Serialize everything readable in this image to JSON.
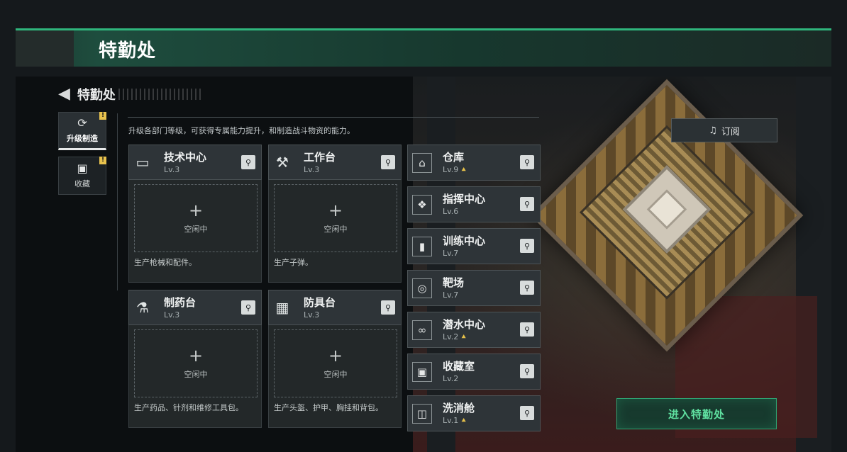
{
  "header": {
    "title": "特勤处"
  },
  "page": {
    "back_title": "特勤处",
    "description": "升级各部门等级，可获得专属能力提升，和制造战斗物资的能力。"
  },
  "sidebar": {
    "tabs": [
      {
        "label": "升级制造",
        "icon": "upgrade-icon",
        "badge": "!"
      },
      {
        "label": "收藏",
        "icon": "collection-icon",
        "badge": "!"
      }
    ]
  },
  "stations": [
    {
      "name": "技术中心",
      "level": "Lv.3",
      "icon": "tech-center-icon",
      "slot_plus": "+",
      "slot_status": "空闲中",
      "desc": "生产枪械和配件。"
    },
    {
      "name": "工作台",
      "level": "Lv.3",
      "icon": "workbench-icon",
      "slot_plus": "+",
      "slot_status": "空闲中",
      "desc": "生产子弹。"
    },
    {
      "name": "制药台",
      "level": "Lv.3",
      "icon": "pharmacy-icon",
      "slot_plus": "+",
      "slot_status": "空闲中",
      "desc": "生产药品、针剂和维修工具包。"
    },
    {
      "name": "防具台",
      "level": "Lv.3",
      "icon": "armor-bench-icon",
      "slot_plus": "+",
      "slot_status": "空闲中",
      "desc": "生产头盔、护甲、胸挂和背包。"
    }
  ],
  "facilities": [
    {
      "name": "仓库",
      "level": "Lv.9",
      "icon": "warehouse-icon",
      "upgradable": true
    },
    {
      "name": "指挥中心",
      "level": "Lv.6",
      "icon": "command-center-icon",
      "upgradable": false
    },
    {
      "name": "训练中心",
      "level": "Lv.7",
      "icon": "training-center-icon",
      "upgradable": false
    },
    {
      "name": "靶场",
      "level": "Lv.7",
      "icon": "shooting-range-icon",
      "upgradable": false
    },
    {
      "name": "潜水中心",
      "level": "Lv.2",
      "icon": "diving-center-icon",
      "upgradable": true
    },
    {
      "name": "收藏室",
      "level": "Lv.2",
      "icon": "collection-room-icon",
      "upgradable": false
    },
    {
      "name": "洗消舱",
      "level": "Lv.1",
      "icon": "decon-pod-icon",
      "upgradable": true
    }
  ],
  "buttons": {
    "subscribe": "订阅",
    "enter": "进入特勤处"
  },
  "colors": {
    "accent": "#2fb57c",
    "upgrade": "#e5c04a",
    "panel": "#2e3438"
  }
}
